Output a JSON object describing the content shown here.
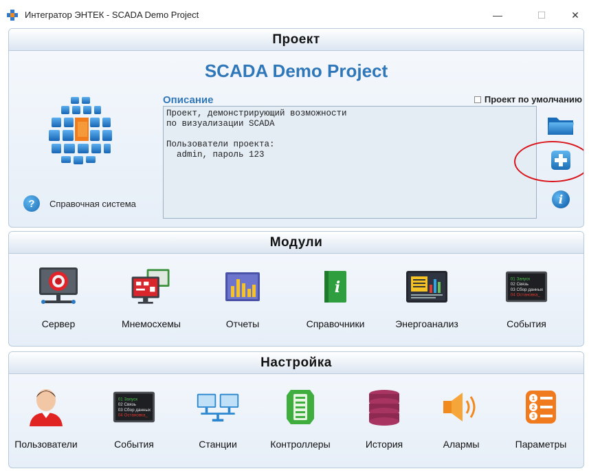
{
  "window": {
    "title": "Интегратор ЭНТЕК - SCADA Demo Project",
    "minimize": "—",
    "maximize": "☐",
    "close": "✕"
  },
  "project": {
    "header": "Проект",
    "name": "SCADA Demo Project",
    "description_label": "Описание",
    "default_label": "Проект по умолчанию",
    "default_checked": false,
    "description_text": "Проект, демонстрирующий возможности\nпо визуализации SCADA\n\nПользователи проекта:\n  admin, пароль 123",
    "help_icon_glyph": "?",
    "help_label": "Справочная система",
    "side_icons": [
      "folder-icon",
      "add-icon",
      "info-icon"
    ]
  },
  "modules": {
    "header": "Модули",
    "items": [
      {
        "label": "Сервер",
        "icon": "server-icon"
      },
      {
        "label": "Мнемосхемы",
        "icon": "mnemonic-icon"
      },
      {
        "label": "Отчеты",
        "icon": "reports-icon"
      },
      {
        "label": "Справочники",
        "icon": "directories-icon"
      },
      {
        "label": "Энергоанализ",
        "icon": "energy-analysis-icon"
      },
      {
        "label": "События",
        "icon": "events-icon"
      }
    ],
    "event_screen_lines": [
      "01 Запуск",
      "02 Связь",
      "03 Сбор данных",
      "04 Остановка_"
    ]
  },
  "settings": {
    "header": "Настройка",
    "items": [
      {
        "label": "Пользователи",
        "icon": "users-icon"
      },
      {
        "label": "События",
        "icon": "events-icon"
      },
      {
        "label": "Станции",
        "icon": "stations-icon"
      },
      {
        "label": "Контроллеры",
        "icon": "controllers-icon"
      },
      {
        "label": "История",
        "icon": "history-icon"
      },
      {
        "label": "Алармы",
        "icon": "alarms-icon"
      },
      {
        "label": "Параметры",
        "icon": "parameters-icon"
      }
    ],
    "parameter_numbers": [
      "1",
      "2",
      "3"
    ]
  },
  "colors": {
    "accent": "#2f77b9",
    "panel_border": "#b9c9dc",
    "highlight": "#d9141a"
  }
}
